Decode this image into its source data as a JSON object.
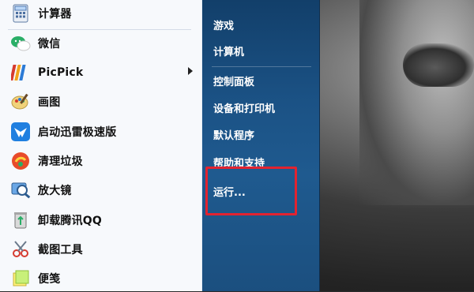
{
  "left_items": [
    {
      "label": "计算器",
      "icon": "calculator-icon",
      "has_submenu": false
    },
    {
      "label": "微信",
      "icon": "wechat-icon",
      "has_submenu": false
    },
    {
      "label": "PicPick",
      "icon": "picpick-icon",
      "has_submenu": true
    },
    {
      "label": "画图",
      "icon": "paint-icon",
      "has_submenu": false
    },
    {
      "label": "启动迅雷极速版",
      "icon": "thunder-icon",
      "has_submenu": false
    },
    {
      "label": "清理垃圾",
      "icon": "cleanup-icon",
      "has_submenu": false
    },
    {
      "label": "放大镜",
      "icon": "magnifier-icon",
      "has_submenu": false
    },
    {
      "label": "卸载腾讯QQ",
      "icon": "recycle-uninstall-icon",
      "has_submenu": false
    },
    {
      "label": "截图工具",
      "icon": "scissors-icon",
      "has_submenu": false
    },
    {
      "label": "便笺",
      "icon": "sticky-notes-icon",
      "has_submenu": false
    }
  ],
  "right_items": [
    {
      "label": "游戏"
    },
    {
      "label": "计算机"
    },
    {
      "label": "控制面板"
    },
    {
      "label": "设备和打印机"
    },
    {
      "label": "默认程序"
    },
    {
      "label": "帮助和支持"
    },
    {
      "label": "运行..."
    }
  ],
  "highlight_color": "#e22330"
}
